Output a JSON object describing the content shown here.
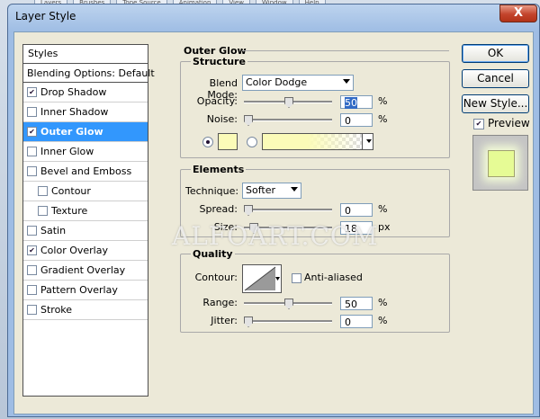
{
  "background": {
    "tabs": [
      "Layers",
      "Brushes",
      "Tone Source",
      "Animation",
      "View",
      "Window",
      "Help"
    ]
  },
  "dialog": {
    "title": "Layer Style",
    "close_glyph": "X"
  },
  "styles_panel": {
    "header": "Styles",
    "blending": "Blending Options: Default",
    "items": [
      {
        "label": "Drop Shadow",
        "checked": true,
        "selected": false,
        "indent": false
      },
      {
        "label": "Inner Shadow",
        "checked": false,
        "selected": false,
        "indent": false
      },
      {
        "label": "Outer Glow",
        "checked": true,
        "selected": true,
        "indent": false
      },
      {
        "label": "Inner Glow",
        "checked": false,
        "selected": false,
        "indent": false
      },
      {
        "label": "Bevel and Emboss",
        "checked": false,
        "selected": false,
        "indent": false
      },
      {
        "label": "Contour",
        "checked": false,
        "selected": false,
        "indent": true
      },
      {
        "label": "Texture",
        "checked": false,
        "selected": false,
        "indent": true
      },
      {
        "label": "Satin",
        "checked": false,
        "selected": false,
        "indent": false
      },
      {
        "label": "Color Overlay",
        "checked": true,
        "selected": false,
        "indent": false
      },
      {
        "label": "Gradient Overlay",
        "checked": false,
        "selected": false,
        "indent": false
      },
      {
        "label": "Pattern Overlay",
        "checked": false,
        "selected": false,
        "indent": false
      },
      {
        "label": "Stroke",
        "checked": false,
        "selected": false,
        "indent": false
      }
    ]
  },
  "outer_glow": {
    "title": "Outer Glow",
    "structure": {
      "title": "Structure",
      "blend_mode_label": "Blend Mode:",
      "blend_mode_value": "Color Dodge",
      "opacity_label": "Opacity:",
      "opacity_value": "50",
      "opacity_unit": "%",
      "opacity_level": 0.5,
      "noise_label": "Noise:",
      "noise_value": "0",
      "noise_unit": "%",
      "noise_level": 0,
      "glow_color": "#fbfbb8",
      "gradient_color": "#fbfbb8"
    },
    "elements": {
      "title": "Elements",
      "technique_label": "Technique:",
      "technique_value": "Softer",
      "spread_label": "Spread:",
      "spread_value": "0",
      "spread_unit": "%",
      "spread_level": 0,
      "size_label": "Size:",
      "size_value": "18",
      "size_unit": "px",
      "size_level": 0.07
    },
    "quality": {
      "title": "Quality",
      "contour_label": "Contour:",
      "anti_aliased_label": "Anti-aliased",
      "anti_aliased": false,
      "range_label": "Range:",
      "range_value": "50",
      "range_unit": "%",
      "range_level": 0.5,
      "jitter_label": "Jitter:",
      "jitter_value": "0",
      "jitter_unit": "%",
      "jitter_level": 0
    }
  },
  "buttons": {
    "ok": "OK",
    "cancel": "Cancel",
    "new_style": "New Style...",
    "preview_label": "Preview",
    "preview_checked": true,
    "preview_color": "#e6fb95"
  },
  "watermark": "ALFOART.COM"
}
